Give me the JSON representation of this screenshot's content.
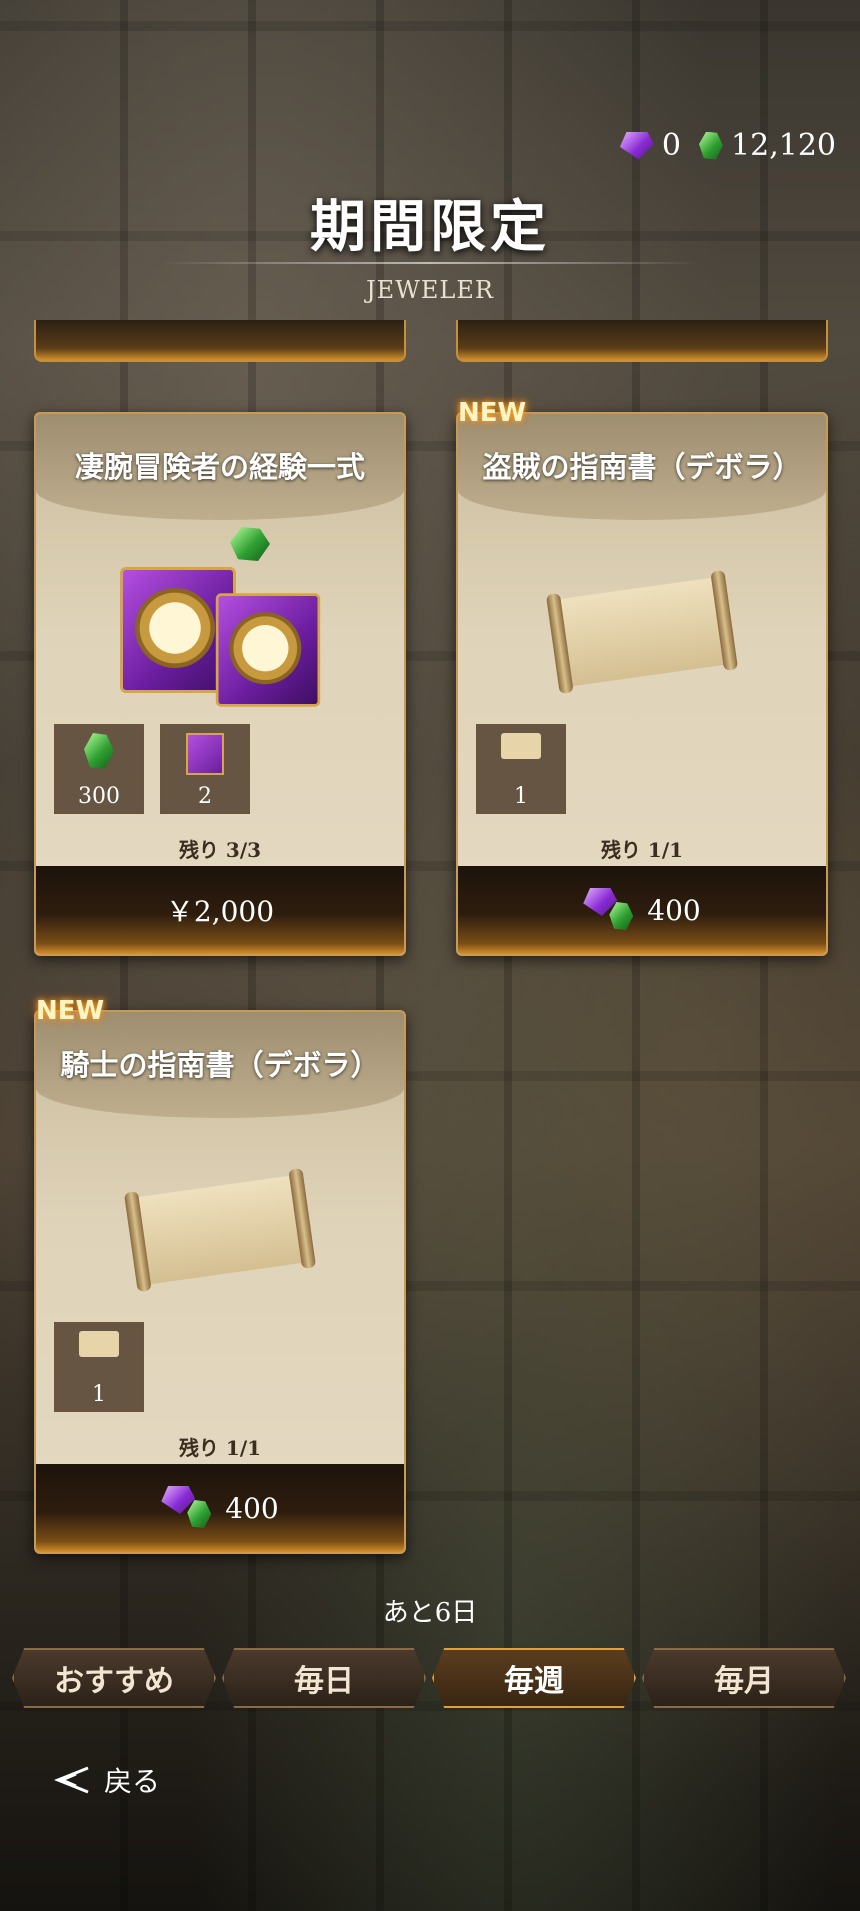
{
  "header": {
    "currency_purple": "0",
    "currency_green": "12,120",
    "title": "期間限定",
    "subtitle": "JEWELER"
  },
  "cards": [
    {
      "title": "凄腕冒険者の経験一式",
      "thumbs": [
        "300",
        "2"
      ],
      "remaining": "残り 3/3",
      "price": "￥2,000"
    },
    {
      "badge": "NEW",
      "title": "盗賊の指南書（デボラ）",
      "thumbs": [
        "1"
      ],
      "remaining": "残り 1/1",
      "price": "400"
    },
    {
      "badge": "NEW",
      "title": "騎士の指南書（デボラ）",
      "thumbs": [
        "1"
      ],
      "remaining": "残り 1/1",
      "price": "400"
    }
  ],
  "footer": {
    "days_left": "あと6日",
    "tabs": [
      "おすすめ",
      "毎日",
      "毎週",
      "毎月"
    ],
    "active_tab": "毎週",
    "back_label": "戻る"
  },
  "colors": {
    "accent": "#d48f2c",
    "card_bg": "#dfd3b9",
    "badge_glow": "#ffb020"
  }
}
